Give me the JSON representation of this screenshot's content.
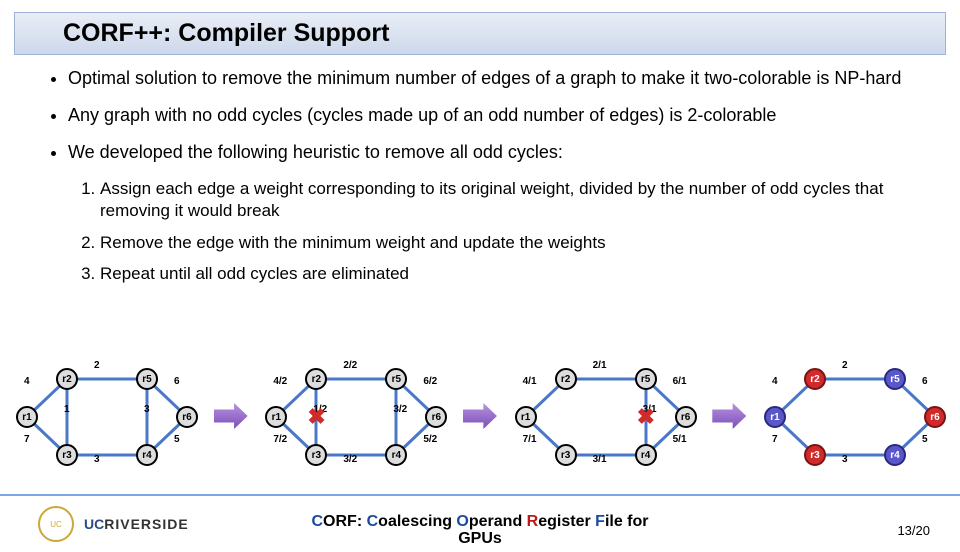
{
  "title": "CORF++: Compiler Support",
  "bullets": [
    "Optimal solution to remove the minimum number of edges of a graph to make it two-colorable is NP-hard",
    "Any graph with no odd cycles (cycles made up of an odd number of edges) is 2-colorable",
    "We developed the following heuristic to remove all odd cycles:"
  ],
  "steps": [
    "Assign each edge a weight corresponding to its original weight, divided by the number of odd cycles that removing it would break",
    "Remove the edge with the minimum weight and update the weights",
    "Repeat until all odd cycles are eliminated"
  ],
  "graphs": {
    "nodes": [
      "r1",
      "r2",
      "r3",
      "r4",
      "r5",
      "r6"
    ],
    "stages": [
      {
        "labels": {
          "r1r2": "4",
          "r2r5": "2",
          "r5r6": "6",
          "r1r3": "7",
          "r3r4": "3",
          "r4r6": "5",
          "r2r3": "1",
          "r4r5": "3"
        },
        "colored": false,
        "cross": null
      },
      {
        "labels": {
          "r1r2": "4/2",
          "r2r5": "2/2",
          "r5r6": "6/2",
          "r1r3": "7/2",
          "r3r4": "3/2",
          "r4r6": "5/2",
          "r2r3": "1/2",
          "r4r5": "3/2"
        },
        "colored": false,
        "cross": "r2r3"
      },
      {
        "labels": {
          "r1r2": "4/1",
          "r2r5": "2/1",
          "r5r6": "6/1",
          "r1r3": "7/1",
          "r3r4": "3/1",
          "r4r6": "5/1",
          "r4r5": "3/1"
        },
        "colored": false,
        "cross": "r4r5"
      },
      {
        "labels": {
          "r1r2": "4",
          "r2r5": "2",
          "r5r6": "6",
          "r1r3": "7",
          "r3r4": "3",
          "r4r6": "5"
        },
        "colored": true,
        "cross": null
      }
    ]
  },
  "footer": {
    "uc": "UC",
    "riverside": "RIVERSIDE",
    "title_prefix": "CORF",
    "title_rest": ": ",
    "parts": {
      "c": "C",
      "oalescing": "oalescing ",
      "o": "O",
      "perand": "perand ",
      "r": "R",
      "egister": "egister ",
      "f": "F",
      "ile": "ile for",
      "gpus": "GPUs"
    }
  },
  "page": {
    "current": 13,
    "total": 20
  }
}
